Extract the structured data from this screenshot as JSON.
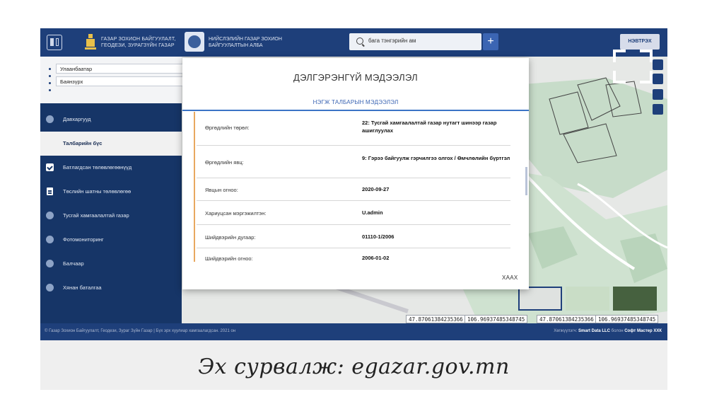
{
  "header": {
    "org1_line1": "ГАЗАР ЗОХИОН БАЙГУУЛАЛТ,",
    "org1_line2": "ГЕОДЕЗИ, ЗУРАГЗҮЙН ГАЗАР",
    "org2_line1": "НИЙСЛЭЛИЙН ГАЗАР ЗОХИОН",
    "org2_line2": "БАЙГУУЛАЛТЫН АЛБА",
    "search_value": "бага тэнгэрийн ам",
    "plus_label": "+",
    "login_label": "НЭВТРЭХ"
  },
  "location": {
    "city": "Улаанбаатар",
    "district": "Баянзүрх"
  },
  "sidebar": {
    "items": [
      {
        "label": "Давхаргууд"
      },
      {
        "label": "Талбарийн бүс"
      },
      {
        "label": "Батлагдсан төлөвлөгөөнүүд"
      },
      {
        "label": "Төслийн шатны төлөвлөгөө"
      },
      {
        "label": "Тусгай хамгаалалтай газар"
      },
      {
        "label": "Фотомониторинг"
      },
      {
        "label": "Балчаар"
      },
      {
        "label": "Хянан баталгаа"
      }
    ]
  },
  "dialog": {
    "title": "ДЭЛГЭРЭНГҮЙ МЭДЭЭЛЭЛ",
    "tab": "НЭГЖ ТАЛБАРЫН МЭДЭЭЛЭЛ",
    "rows": [
      {
        "key": "Өргөдлийн төрөл:",
        "value": "22: Тусгай хамгаалалтай газар нутагт шинээр газар ашиглуулах"
      },
      {
        "key": "Өргөдлийн явц:",
        "value": "9: Гэрээ байгуулж гэрчилгээ олгох / Өмчлөлийн бүртгэл"
      },
      {
        "key": "Явцын огноо:",
        "value": "2020-09-27"
      },
      {
        "key": "Хариуцсан мэргэжилтэн:",
        "value": "U.admin"
      },
      {
        "key": "Шийдвэрийн дугаар:",
        "value": "01110-1/2006"
      },
      {
        "key": "Шийдвэрийн огноо:",
        "value": "2006-01-02"
      }
    ],
    "close_label": "ХААХ"
  },
  "coords": {
    "a_lat": "47.87061384235366",
    "a_lon": "106.96937485348745",
    "b_lat": "47.87061384235366",
    "b_lon": "106.96937485348745"
  },
  "footer": {
    "left": "© Газар Зохион Байгуулалт, Геодези, Зураг Зүйн Газар | Бүх эрх хуулиар хамгаалагдсан. 2021 он",
    "right_prefix": "Хөгжүүлэгч: ",
    "right_company1": "Smart Data LLC",
    "right_middle": " болон ",
    "right_company2": "Софт Мастер ХХК"
  },
  "caption": "Эх сурвалж: egazar.gov.mn",
  "colors": {
    "navy": "#1e3f7a",
    "sidebar": "#163567",
    "accent": "#3b74c6",
    "orange_rule": "#e8a860"
  }
}
